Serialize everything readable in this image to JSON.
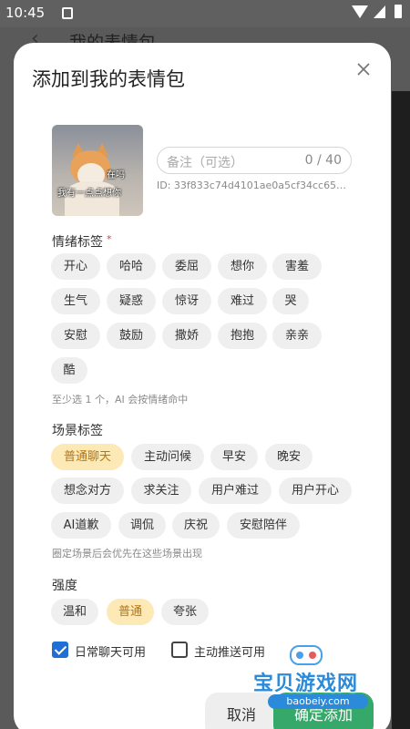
{
  "status_bar": {
    "time": "10:45"
  },
  "background_header": {
    "title": "我的表情包"
  },
  "dialog": {
    "title": "添加到我的表情包",
    "sticker": {
      "caption_top": "在吗",
      "caption_bottom": "我有一点点想你"
    },
    "note": {
      "placeholder": "备注（可选）",
      "counter": "0 / 40",
      "id_text": "ID: 33f833c74d4101ae0a5cf34cc65…"
    },
    "emotion": {
      "label": "情绪标签",
      "required_mark": "*",
      "tags": [
        "开心",
        "哈哈",
        "委屈",
        "想你",
        "害羞",
        "生气",
        "疑惑",
        "惊讶",
        "难过",
        "哭",
        "安慰",
        "鼓励",
        "撒娇",
        "抱抱",
        "亲亲",
        "酷"
      ],
      "hint": "至少选 1 个，AI 会按情绪命中"
    },
    "scene": {
      "label": "场景标签",
      "tags": [
        "普通聊天",
        "主动问候",
        "早安",
        "晚安",
        "想念对方",
        "求关注",
        "用户难过",
        "用户开心",
        "AI道歉",
        "调侃",
        "庆祝",
        "安慰陪伴"
      ],
      "selected": "普通聊天",
      "hint": "圈定场景后会优先在这些场景出现"
    },
    "intensity": {
      "label": "强度",
      "options": [
        "温和",
        "普通",
        "夸张"
      ],
      "selected": "普通"
    },
    "checkboxes": [
      {
        "label": "日常聊天可用",
        "checked": true
      },
      {
        "label": "主动推送可用",
        "checked": false
      }
    ],
    "buttons": {
      "cancel": "取消",
      "confirm": "确定添加"
    },
    "colors": {
      "selected_chip_bg": "#fde9b5",
      "selected_chip_text": "#b87410",
      "checkbox": "#1f6fd6",
      "confirm": "#35a86a"
    }
  },
  "watermark": {
    "text": "宝贝游戏网",
    "url": "baobeiy.com"
  }
}
